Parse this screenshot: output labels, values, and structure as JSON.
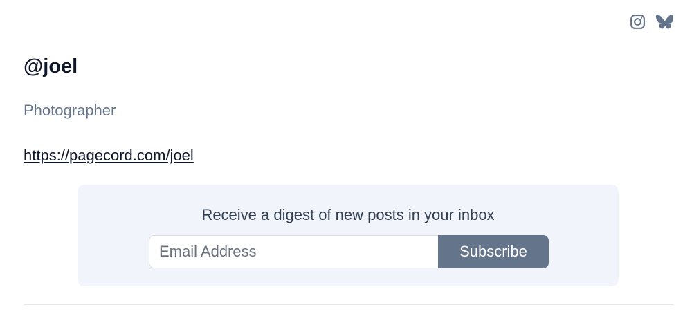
{
  "social": {
    "links": [
      {
        "icon": "instagram-icon"
      },
      {
        "icon": "bluesky-icon"
      }
    ]
  },
  "profile": {
    "handle": "@joel",
    "bio": "Photographer",
    "url": "https://pagecord.com/joel"
  },
  "digest": {
    "title": "Receive a digest of new posts in your inbox",
    "email_placeholder": "Email Address",
    "email_value": "",
    "subscribe_label": "Subscribe"
  },
  "colors": {
    "accent": "#64748b",
    "panel_background": "#f1f5fb",
    "text_dark": "#0f172a",
    "text_muted": "#64748b"
  }
}
